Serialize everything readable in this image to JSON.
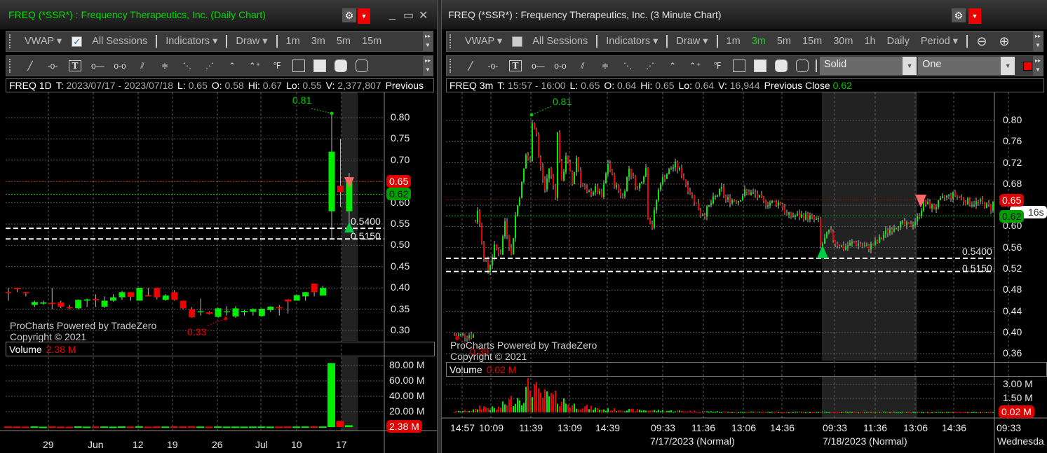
{
  "colors": {
    "up": "#00ee00",
    "down": "#ee0000",
    "wick": "#bbbbbb",
    "grid": "#5a5a5a",
    "last": "#e00000",
    "prev": "#00a000",
    "level": "#ffffff"
  },
  "left": {
    "title": "FREQ (*SSR*) : Frequency Therapeutics, Inc. (Daily Chart)",
    "title_color": "#00dd00",
    "toolbar": {
      "vwap": "VWAP",
      "vwap_checked": true,
      "all_sessions": "All Sessions",
      "indicators": "Indicators",
      "draw": "Draw",
      "intervals": [
        "1m",
        "3m",
        "5m",
        "15m"
      ]
    },
    "draw_tools": [
      "trend-line",
      "ray-segment",
      "text",
      "horizontal-ray",
      "extended-line",
      "parallel-channel",
      "horizontal-channel",
      "regression-channel",
      "alt-channel",
      "polyline",
      "arrow-line",
      "fibonacci",
      "rectangle-outline",
      "rectangle-filled",
      "rounded-rect-filled",
      "rounded-rect-outline"
    ],
    "info": [
      {
        "label": "FREQ 1D",
        "value": ""
      },
      {
        "label": "T:",
        "value": "2023/07/17 - 2023/07/18"
      },
      {
        "label": "L:",
        "value": "0.65"
      },
      {
        "label": "O:",
        "value": "0.58"
      },
      {
        "label": "Hi:",
        "value": "0.67"
      },
      {
        "label": "Lo:",
        "value": "0.55"
      },
      {
        "label": "V:",
        "value": "2,377,807"
      },
      {
        "label": "Previous",
        "value": ""
      }
    ],
    "y_ticks": [
      "0.80",
      "0.75",
      "0.70",
      "0.65",
      "0.60",
      "0.55",
      "0.50",
      "0.45",
      "0.40",
      "0.35",
      "0.30"
    ],
    "x_ticks": [
      "29",
      "Jun",
      "12",
      "19",
      "26",
      "Jul",
      "10",
      "17"
    ],
    "last_tag": "0.65",
    "prev_close_tag": "0.62",
    "last": 0.65,
    "prev_close": 0.62,
    "levels": [
      {
        "value": 0.54,
        "label": "0.5400"
      },
      {
        "value": 0.515,
        "label": "0.5150"
      }
    ],
    "high_marker": "0.81",
    "low_marker": "0.33",
    "watermark": [
      "ProCharts Powered by TradeZero",
      "Copyright © 2021"
    ],
    "volume": {
      "label": "Volume",
      "value": "2.38 M",
      "ticks": [
        "80.00 M",
        "60.00 M",
        "40.00 M",
        "20.00 M"
      ],
      "tag": "2.38 M"
    },
    "candles": [
      [
        0.39,
        0.4,
        0.37,
        0.388
      ],
      [
        0.4,
        0.4,
        0.39,
        0.397
      ],
      [
        0.39,
        0.39,
        0.38,
        0.387
      ],
      [
        0.36,
        0.37,
        0.355,
        0.367
      ],
      [
        0.363,
        0.37,
        0.36,
        0.366
      ],
      [
        0.365,
        0.4,
        0.35,
        0.362
      ],
      [
        0.366,
        0.37,
        0.352,
        0.356
      ],
      [
        0.355,
        0.36,
        0.35,
        0.352
      ],
      [
        0.352,
        0.373,
        0.35,
        0.372
      ],
      [
        0.37,
        0.375,
        0.355,
        0.373
      ],
      [
        0.374,
        0.385,
        0.355,
        0.371
      ],
      [
        0.356,
        0.38,
        0.353,
        0.37
      ],
      [
        0.37,
        0.385,
        0.368,
        0.378
      ],
      [
        0.378,
        0.393,
        0.372,
        0.39
      ],
      [
        0.39,
        0.39,
        0.37,
        0.379
      ],
      [
        0.37,
        0.4,
        0.37,
        0.4
      ],
      [
        0.383,
        0.4,
        0.38,
        0.38
      ],
      [
        0.4,
        0.4,
        0.373,
        0.378
      ],
      [
        0.372,
        0.385,
        0.37,
        0.382
      ],
      [
        0.39,
        0.395,
        0.37,
        0.372
      ],
      [
        0.37,
        0.37,
        0.35,
        0.352
      ],
      [
        0.35,
        0.355,
        0.33,
        0.331
      ],
      [
        0.343,
        0.375,
        0.335,
        0.345
      ],
      [
        0.343,
        0.345,
        0.338,
        0.339
      ],
      [
        0.332,
        0.353,
        0.33,
        0.352
      ],
      [
        0.343,
        0.357,
        0.335,
        0.345
      ],
      [
        0.333,
        0.357,
        0.33,
        0.352
      ],
      [
        0.343,
        0.348,
        0.335,
        0.346
      ],
      [
        0.344,
        0.352,
        0.335,
        0.35
      ],
      [
        0.334,
        0.352,
        0.333,
        0.351
      ],
      [
        0.348,
        0.357,
        0.343,
        0.356
      ],
      [
        0.355,
        0.36,
        0.335,
        0.352
      ],
      [
        0.373,
        0.373,
        0.34,
        0.368
      ],
      [
        0.37,
        0.385,
        0.37,
        0.383
      ],
      [
        0.38,
        0.39,
        0.37,
        0.39
      ],
      [
        0.41,
        0.41,
        0.38,
        0.39
      ],
      [
        0.382,
        0.405,
        0.382,
        0.4
      ],
      [
        0.58,
        0.81,
        0.515,
        0.72
      ],
      [
        0.64,
        0.75,
        0.59,
        0.625
      ],
      [
        0.58,
        0.67,
        0.55,
        0.65
      ]
    ],
    "volumes_m": [
      0.8,
      0.7,
      0.6,
      0.9,
      0.5,
      0.8,
      0.6,
      0.5,
      0.9,
      0.6,
      0.7,
      0.8,
      0.6,
      0.9,
      0.7,
      1.0,
      0.6,
      0.8,
      0.7,
      0.9,
      0.8,
      1.0,
      0.7,
      0.6,
      0.8,
      0.6,
      0.7,
      0.6,
      0.7,
      0.8,
      0.6,
      0.7,
      0.8,
      0.7,
      0.8,
      0.9,
      0.8,
      83,
      8,
      2.38
    ]
  },
  "right": {
    "title": "FREQ (*SSR*) : Frequency Therapeutics, Inc. (3 Minute Chart)",
    "title_color": "#e0e0e0",
    "toolbar": {
      "vwap": "VWAP",
      "vwap_checked": false,
      "all_sessions": "All Sessions",
      "indicators": "Indicators",
      "draw": "Draw",
      "intervals": [
        "1m",
        "3m",
        "5m",
        "15m",
        "30m",
        "1h",
        "Daily"
      ],
      "active_interval": "3m",
      "period": "Period",
      "line_style": "Solid",
      "line_width": "One",
      "line_color": "#ee0000"
    },
    "info": [
      {
        "label": "FREQ 3m",
        "value": ""
      },
      {
        "label": "T:",
        "value": "15:57 - 16:00"
      },
      {
        "label": "L:",
        "value": "0.65"
      },
      {
        "label": "O:",
        "value": "0.64"
      },
      {
        "label": "Hi:",
        "value": "0.65"
      },
      {
        "label": "Lo:",
        "value": "0.64"
      },
      {
        "label": "V:",
        "value": "16,944"
      },
      {
        "label": "Previous Close",
        "value": "0.62",
        "value_color": "#00cc00"
      }
    ],
    "y_ticks": [
      "0.80",
      "0.76",
      "0.72",
      "0.68",
      "0.64",
      "0.60",
      "0.56",
      "0.52",
      "0.48",
      "0.44",
      "0.40",
      "0.36"
    ],
    "x_ticks": [
      "14:57",
      "10:09",
      "11:39",
      "13:09",
      "14:39",
      "09:33",
      "11:36",
      "13:06",
      "14:36",
      "09:33",
      "11:36",
      "13:06",
      "14:36",
      "09:33"
    ],
    "x_dates": [
      "7/17/2023 (Normal)",
      "7/18/2023 (Normal)",
      "Wednesda"
    ],
    "last_tag": "0.65",
    "prev_close_tag": "0.62",
    "countdown": "16s",
    "last": 0.65,
    "prev_close": 0.62,
    "levels": [
      {
        "value": 0.54,
        "label": "0.5400"
      },
      {
        "value": 0.515,
        "label": "0.5150"
      }
    ],
    "high_marker": "0.81",
    "low_marker": "0.39",
    "watermark": [
      "ProCharts Powered by TradeZero",
      "Copyright © 2021"
    ],
    "volume": {
      "label": "Volume",
      "value": "0.02 M",
      "ticks": [
        "3.00 M",
        "1.50 M"
      ],
      "tag": "0.02 M"
    },
    "price_path": [
      [
        0,
        0.395
      ],
      [
        9,
        0.395
      ],
      [
        10,
        0.61
      ],
      [
        11,
        0.633
      ],
      [
        14,
        0.545
      ],
      [
        16,
        0.515
      ],
      [
        19,
        0.56
      ],
      [
        22,
        0.55
      ],
      [
        24,
        0.61
      ],
      [
        27,
        0.545
      ],
      [
        29,
        0.62
      ],
      [
        32,
        0.68
      ],
      [
        34,
        0.735
      ],
      [
        36,
        0.72
      ],
      [
        37,
        0.8
      ],
      [
        39,
        0.775
      ],
      [
        40,
        0.73
      ],
      [
        43,
        0.67
      ],
      [
        45,
        0.71
      ],
      [
        48,
        0.66
      ],
      [
        49,
        0.775
      ],
      [
        51,
        0.68
      ],
      [
        53,
        0.735
      ],
      [
        56,
        0.68
      ],
      [
        58,
        0.73
      ],
      [
        60,
        0.685
      ],
      [
        63,
        0.66
      ],
      [
        67,
        0.67
      ],
      [
        70,
        0.655
      ],
      [
        73,
        0.72
      ],
      [
        76,
        0.68
      ],
      [
        80,
        0.655
      ],
      [
        83,
        0.71
      ],
      [
        87,
        0.67
      ],
      [
        91,
        0.71
      ],
      [
        92,
        0.62
      ],
      [
        94,
        0.6
      ],
      [
        96,
        0.65
      ],
      [
        98,
        0.685
      ],
      [
        103,
        0.71
      ],
      [
        105,
        0.715
      ],
      [
        108,
        0.7
      ],
      [
        110,
        0.68
      ],
      [
        114,
        0.65
      ],
      [
        117,
        0.625
      ],
      [
        119,
        0.625
      ],
      [
        123,
        0.65
      ],
      [
        127,
        0.67
      ],
      [
        129,
        0.65
      ],
      [
        135,
        0.65
      ],
      [
        138,
        0.665
      ],
      [
        143,
        0.66
      ],
      [
        147,
        0.645
      ],
      [
        155,
        0.645
      ],
      [
        158,
        0.62
      ],
      [
        163,
        0.62
      ],
      [
        167,
        0.62
      ],
      [
        173,
        0.61
      ],
      [
        174,
        0.56
      ],
      [
        178,
        0.59
      ],
      [
        181,
        0.57
      ],
      [
        185,
        0.56
      ],
      [
        190,
        0.57
      ],
      [
        196,
        0.56
      ],
      [
        201,
        0.57
      ],
      [
        204,
        0.585
      ],
      [
        207,
        0.595
      ],
      [
        211,
        0.605
      ],
      [
        216,
        0.6
      ],
      [
        220,
        0.615
      ],
      [
        223,
        0.645
      ],
      [
        228,
        0.635
      ],
      [
        233,
        0.655
      ],
      [
        238,
        0.66
      ],
      [
        242,
        0.65
      ],
      [
        245,
        0.645
      ],
      [
        250,
        0.645
      ],
      [
        255,
        0.635
      ],
      [
        256,
        0.645
      ]
    ],
    "volume_path_m": [
      [
        0,
        0.1
      ],
      [
        10,
        0.3
      ],
      [
        12,
        0.7
      ],
      [
        20,
        0.4
      ],
      [
        28,
        1.6
      ],
      [
        33,
        2.0
      ],
      [
        37,
        3.5
      ],
      [
        40,
        2.0
      ],
      [
        50,
        1.6
      ],
      [
        55,
        0.9
      ],
      [
        70,
        0.35
      ],
      [
        100,
        0.2
      ],
      [
        130,
        0.08
      ],
      [
        256,
        0.05
      ]
    ]
  }
}
